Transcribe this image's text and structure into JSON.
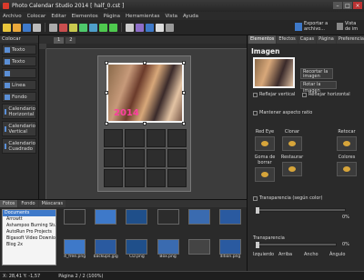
{
  "window": {
    "title": "Photo Calendar Studio 2014 [ half_0.cst ]"
  },
  "menu": [
    "Archivo",
    "Colocar",
    "Editar",
    "Elementos",
    "Página",
    "Herramientas",
    "Vista",
    "Ayuda"
  ],
  "toolbar": {
    "icons": [
      {
        "name": "new-icon",
        "color": "#e9c53b"
      },
      {
        "name": "open-icon",
        "color": "#e9a83b"
      },
      {
        "name": "save-icon",
        "color": "#3e79c9"
      },
      {
        "name": "print-icon",
        "color": "#bbbbbb"
      },
      {
        "name": "sep"
      },
      {
        "name": "move-icon",
        "color": "#aaaaaa"
      },
      {
        "name": "brush-icon",
        "color": "#c94e4e"
      },
      {
        "name": "pencil-icon",
        "color": "#c9c94e"
      },
      {
        "name": "rotate-icon",
        "color": "#4ec96b"
      },
      {
        "name": "copy-icon",
        "color": "#4e9ec9"
      },
      {
        "name": "undo-icon",
        "color": "#4ec94e"
      },
      {
        "name": "redo-icon",
        "color": "#4ec94e"
      },
      {
        "name": "sep"
      },
      {
        "name": "crop-icon",
        "color": "#cccccc"
      },
      {
        "name": "magic-icon",
        "color": "#8e6ec9"
      },
      {
        "name": "layers-icon",
        "color": "#3e79c9"
      },
      {
        "name": "zoom-icon",
        "color": "#dddddd"
      },
      {
        "name": "grid-icon",
        "color": "#999999"
      }
    ],
    "export_label": "Exportar a archivo...",
    "view_label": "Vista de im"
  },
  "left_panel": {
    "header": "Colocar",
    "items": [
      "Texto",
      "Texto",
      "",
      "Línea",
      "Fondo",
      "Calendario Horizontal",
      "Calendario Vertical",
      "Calendario Cuadrado"
    ]
  },
  "canvas": {
    "tabs": [
      "1",
      "2"
    ],
    "year_text": "2014"
  },
  "right_panel": {
    "tabs": [
      "Elementos",
      "Efectos",
      "Capas",
      "Página",
      "Preferencias"
    ],
    "title": "Imagen",
    "crop_label": "Recortar la imagen",
    "rotate_label": "Rotar la imagen",
    "check_vertical": "Reflejar vertical",
    "check_horizontal": "Reflejar horizontal",
    "keep_ratio": "Mantener aspecto ratio",
    "effects": [
      "Red Eye",
      "Clonar",
      "",
      "Retocar",
      "Goma de borrar",
      "Restaurar",
      "",
      "Colores"
    ],
    "transparency_label": "Transparencia (según color)",
    "transparency_value": "0%",
    "section_label": "Transparencia",
    "opacity_value": "0%",
    "fields": [
      "Izquierdo",
      "Arriba",
      "Ancho",
      "Ángulo"
    ]
  },
  "bottom_panel": {
    "tabs": [
      "Fotos",
      "Fondo",
      "Máscaras"
    ],
    "selected_folder": "Documents",
    "folders": [
      "Arrowtt",
      "Ashampoo Burning Studio",
      "AutoRun Pro Projects",
      "Bigasoft Video Downloader Pro",
      "Blog 2x"
    ],
    "files": [
      "",
      "",
      "",
      "",
      "",
      "",
      "4_free.png",
      "backups.jpg",
      "CD.png",
      "Box.png",
      "",
      "dition.png"
    ],
    "file_colors": [
      "#2c2c2c",
      "#3e79c9",
      "#1f4f8a",
      "#2c2c2c",
      "#3a6bb0",
      "#2a5aa0",
      "#3e79c9",
      "#2a5aa0",
      "#1f4f8a",
      "#3a6bb0",
      "#444444",
      "#2a5aa0"
    ]
  },
  "status": {
    "coords": "X: 28,41  Y: -1,57",
    "page": "Página 2 / 2 (100%)"
  }
}
